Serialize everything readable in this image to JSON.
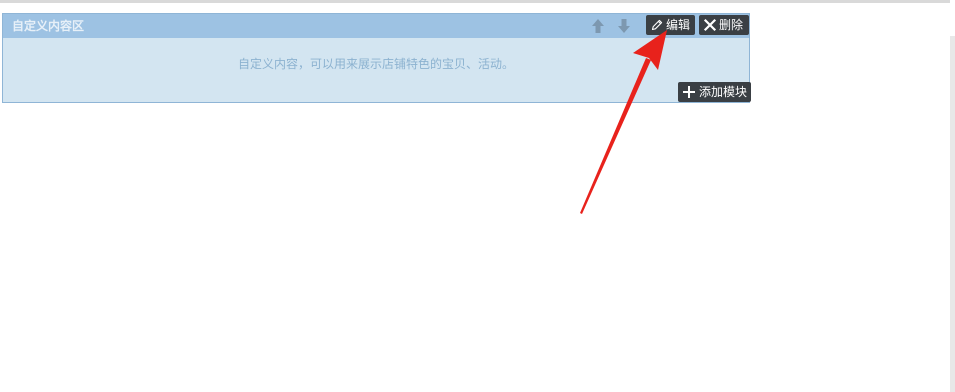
{
  "module": {
    "title": "自定义内容区",
    "body_text": "自定义内容，可以用来展示店铺特色的宝贝、活动。",
    "move_up_icon": "arrow-up-icon",
    "move_down_icon": "arrow-down-icon",
    "edit": {
      "label": "编辑",
      "icon": "pencil-icon"
    },
    "delete": {
      "label": "删除",
      "icon": "close-icon"
    }
  },
  "add_module": {
    "label": "添加模块",
    "icon": "plus-icon"
  },
  "colors": {
    "header": "#9dc2e3",
    "body": "#d3e5f1",
    "button": "#3a3f44",
    "annotation_arrow": "#e8221c"
  }
}
